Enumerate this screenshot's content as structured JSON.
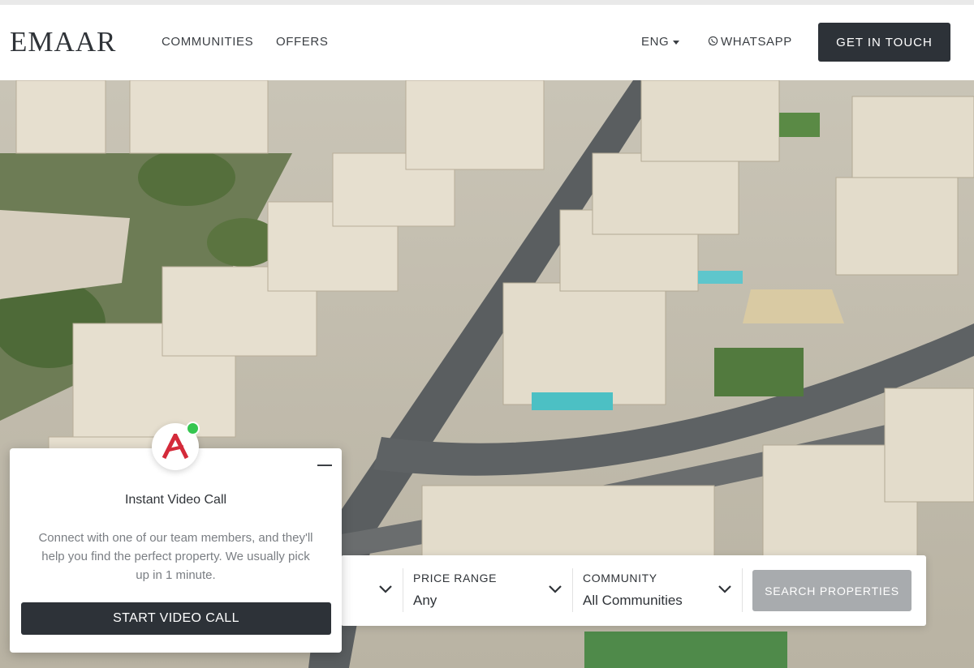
{
  "brand": {
    "logo_text": "EMAAR"
  },
  "nav": {
    "links": [
      "COMMUNITIES",
      "OFFERS"
    ],
    "language": "ENG",
    "whatsapp_label": "WHATSAPP",
    "cta_label": "GET IN TOUCH"
  },
  "search": {
    "price_range": {
      "label": "PRICE RANGE",
      "value": "Any"
    },
    "community": {
      "label": "COMMUNITY",
      "value": "All Communities"
    },
    "button_label": "SEARCH PROPERTIES"
  },
  "video_call": {
    "title": "Instant Video Call",
    "description": "Connect with one of our team members, and they'll help you find the perfect property. We usually pick up in 1 minute.",
    "button_label": "START VIDEO CALL",
    "avatar_letter": "A",
    "status": "online"
  },
  "colors": {
    "dark_button": "#2d3238",
    "search_button": "#a8abae",
    "avatar_accent": "#d42a3a",
    "online": "#35c650"
  },
  "icons": {
    "whatsapp": "whatsapp-icon",
    "language_caret": "caret-down-icon",
    "dropdown": "chevron-down-icon",
    "minimize": "minimize-icon"
  }
}
